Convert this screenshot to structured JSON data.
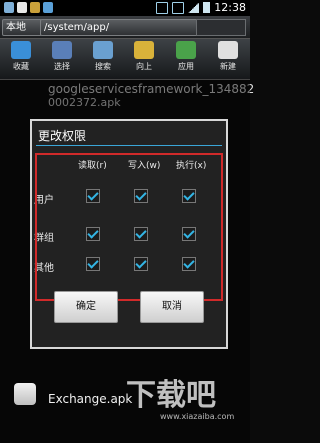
{
  "status_bar": {
    "time": "12:38"
  },
  "path_bar": {
    "home_label": "本地",
    "path": "/system/app/"
  },
  "toolbar": {
    "items": [
      {
        "label": "收藏",
        "icon": "star-icon",
        "color": "#3a8fd8"
      },
      {
        "label": "选择",
        "icon": "select-icon",
        "color": "#5a7fb8"
      },
      {
        "label": "搜索",
        "icon": "search-icon",
        "color": "#6aa0d0"
      },
      {
        "label": "向上",
        "icon": "folder-up-icon",
        "color": "#d9b23a"
      },
      {
        "label": "应用",
        "icon": "apps-icon",
        "color": "#4aa24a"
      },
      {
        "label": "新建",
        "icon": "new-icon",
        "color": "#e0e0e0"
      }
    ]
  },
  "files": {
    "top_name": "googleservicesframework_134882",
    "top_sub": "0002372.apk",
    "bottom_name": "Exchange.apk"
  },
  "dialog": {
    "title": "更改权限",
    "columns": [
      "读取(r)",
      "写入(w)",
      "执行(x)"
    ],
    "rows": [
      {
        "label": "用户",
        "checks": [
          true,
          true,
          true
        ]
      },
      {
        "label": "群组",
        "checks": [
          true,
          true,
          true
        ]
      },
      {
        "label": "其他",
        "checks": [
          true,
          true,
          true
        ]
      }
    ],
    "ok_label": "确定",
    "cancel_label": "取消",
    "accent": "#33b5e5",
    "highlight": "#d12a2a"
  },
  "watermark": {
    "text": "下载吧",
    "url": "www.xiazaiba.com"
  }
}
